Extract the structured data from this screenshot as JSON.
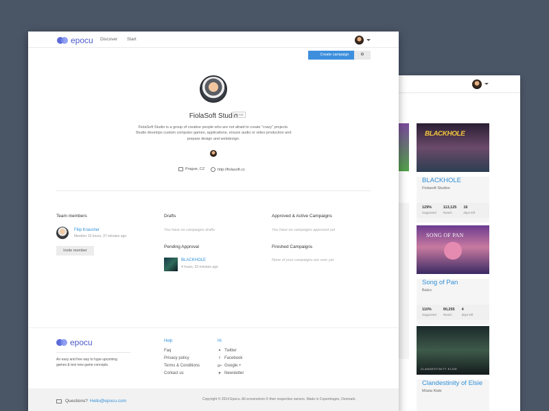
{
  "back_window": {
    "cards": [
      {
        "title": "BLACKHOLE",
        "studio": "Fiolasoft Studios",
        "stats": [
          {
            "value": "129%",
            "label": "Supported"
          },
          {
            "value": "113,125",
            "label": "Reach"
          },
          {
            "value": "16",
            "label": "days left"
          }
        ]
      },
      {
        "title": "Song of Pan",
        "studio": "Balzo",
        "stats": [
          {
            "value": "110%",
            "label": "Supported"
          },
          {
            "value": "90,255",
            "label": "Reach"
          },
          {
            "value": "4",
            "label": "days left"
          }
        ]
      },
      {
        "title": "Clandestinity of Elsie",
        "studio": "Mùsta Klaki"
      }
    ],
    "art_text": {
      "blackhole": "BLACKHOLE",
      "songofpan": "SONG OF PAN",
      "clandestinity": "CLANDESTINITY ELSIE"
    }
  },
  "topbar": {
    "logo_text": "epocu",
    "nav": [
      "Discover",
      "Start"
    ]
  },
  "toolbar": {
    "create_label": "Create campaign",
    "gear_icon": "gear-icon"
  },
  "profile": {
    "name": "FiolaSoft Studio",
    "badge": "TEAM",
    "bio_lines": [
      "FiolaSoft Studio is a group of creative people who are not afraid to create \"crazy\" projects.",
      "Studio develops custom computer games, applications, ensure audio or video production and",
      "prepare design and webdesign."
    ],
    "location": "Prague, CZ",
    "website": "http://fiolasoft.cz"
  },
  "team": {
    "title": "Team members",
    "members": [
      {
        "name": "Filip Kraucher",
        "sub": "Member 15 hours, 37 minutes ago"
      }
    ],
    "invite_label": "Invite member"
  },
  "drafts": {
    "title": "Drafts",
    "empty": "You have no campaigns drafts"
  },
  "pending": {
    "title": "Pending Approval",
    "items": [
      {
        "title": "BLACKHOLE",
        "time": "4 hours, 33 minutes ago"
      }
    ]
  },
  "approved": {
    "title": "Approved & Active Campaigns",
    "empty": "You have no campaigns approved yet"
  },
  "finished": {
    "title": "Finished Campaigns",
    "empty": "None of your campaigns are over yet"
  },
  "footer": {
    "logo_text": "epocu",
    "description_lines": [
      "An easy and free way to hype upcoming",
      "games & test new game concepts."
    ],
    "help": {
      "title": "Help",
      "links": [
        "Faq",
        "Privacy policy",
        "Terms & Conditions",
        "Contact us"
      ]
    },
    "hi": {
      "title": "Hi",
      "links": [
        "Twitter",
        "Facebook",
        "Google +",
        "Newsletter"
      ]
    },
    "questions_label": "Questions?",
    "email": "Hello@epocu.com",
    "copyright": "Copyright © 2014 Epocu. All screenshots © their respective owners. Made in Copenhagen, Denmark."
  },
  "colors": {
    "accent": "#3d8fdd",
    "brand": "#5c6bd8",
    "backdrop": "#4a5566"
  }
}
